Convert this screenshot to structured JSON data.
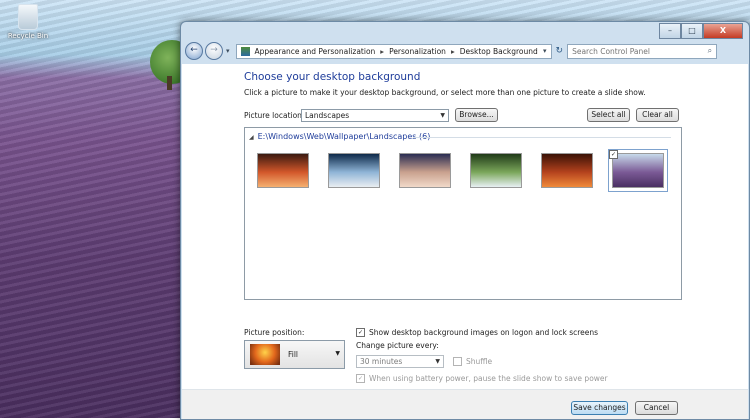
{
  "desktop": {
    "recycle_bin_label": "Recycle Bin"
  },
  "window": {
    "caption": {
      "min": "–",
      "max": "□",
      "close": "X"
    },
    "nav": {
      "back": "←",
      "forward": "→",
      "dropdown": "▾",
      "breadcrumb": [
        "Appearance and Personalization",
        "Personalization",
        "Desktop Background"
      ],
      "refresh": "↻"
    },
    "search": {
      "placeholder": "Search Control Panel",
      "icon": "magnifier-icon"
    }
  },
  "main": {
    "title": "Choose your desktop background",
    "subtitle": "Click a picture to make it your desktop background, or select more than one picture to create a slide show.",
    "picture_location_label": "Picture location:",
    "picture_location_value": "Landscapes",
    "browse_label": "Browse...",
    "select_all_label": "Select all",
    "clear_all_label": "Clear all",
    "group_title": "E:\\Windows\\Web\\Wallpaper\\Landscapes (6)",
    "thumbnails": [
      {
        "colors": [
          "#3b1a10",
          "#d2572a",
          "#f5b070"
        ],
        "selected": false
      },
      {
        "colors": [
          "#0e2a4a",
          "#8fb4d6",
          "#e9eef2"
        ],
        "selected": false
      },
      {
        "colors": [
          "#2a2d52",
          "#c9a18e",
          "#f1d9c9"
        ],
        "selected": false
      },
      {
        "colors": [
          "#1f3a18",
          "#7aa65a",
          "#e8f0f4"
        ],
        "selected": false
      },
      {
        "colors": [
          "#3a1206",
          "#b4421d",
          "#f08a3a"
        ],
        "selected": false
      },
      {
        "colors": [
          "#c7d9ea",
          "#7b5a96",
          "#4a2f62"
        ],
        "selected": true
      }
    ],
    "picture_position_label": "Picture position:",
    "picture_position_value": "Fill",
    "show_on_logon_label": "Show desktop background images on logon and lock screens",
    "change_every_label": "Change picture every:",
    "interval_value": "30 minutes",
    "shuffle_label": "Shuffle",
    "battery_label": "When using battery power, pause the slide show to save power",
    "check_mark": "✓",
    "save_label": "Save changes",
    "cancel_label": "Cancel"
  }
}
